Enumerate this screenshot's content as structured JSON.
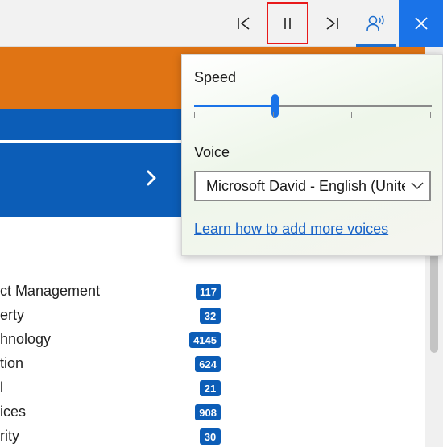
{
  "toolbar": {
    "previous_icon": "skip-previous-icon",
    "pause_icon": "pause-icon",
    "next_icon": "skip-next-icon",
    "voice_icon": "voice-settings-icon",
    "close_icon": "close-icon",
    "accent_color": "#1a73e8",
    "highlight_color": "#e8191a"
  },
  "page": {
    "orange_color": "#e07414",
    "blue_color": "#0c5db7",
    "chevron_icon": "chevron-right-icon",
    "categories": [
      {
        "name": "ct Management",
        "count": "117"
      },
      {
        "name": "erty",
        "count": "32"
      },
      {
        "name": "hnology",
        "count": "4145"
      },
      {
        "name": "tion",
        "count": "624"
      },
      {
        "name": "l",
        "count": "21"
      },
      {
        "name": "ices",
        "count": "908"
      },
      {
        "name": "rity",
        "count": "30"
      }
    ]
  },
  "voice_panel": {
    "speed_label": "Speed",
    "speed_level": 0.34,
    "speed_ticks": 7,
    "voice_label": "Voice",
    "voice_selected": "Microsoft David - English (United States)",
    "voice_select_icon": "chevron-down-icon",
    "learn_link": "Learn how to add more voices"
  }
}
